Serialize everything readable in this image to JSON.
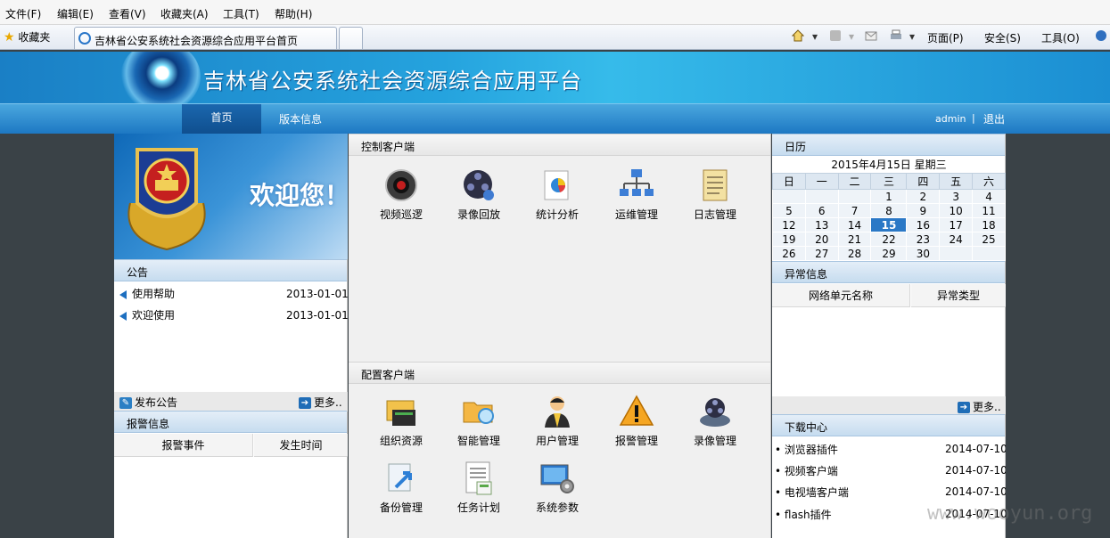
{
  "browser": {
    "menus": [
      "文件(F)",
      "编辑(E)",
      "查看(V)",
      "收藏夹(A)",
      "工具(T)",
      "帮助(H)"
    ],
    "favorites": "收藏夹",
    "tab_title": "吉林省公安系统社会资源综合应用平台首页",
    "cmd_page": "页面(P)",
    "cmd_safety": "安全(S)",
    "cmd_tools": "工具(O)"
  },
  "header": {
    "title": "吉林省公安系统社会资源综合应用平台",
    "nav_home": "首页",
    "nav_version": "版本信息",
    "user": "admin",
    "separator": "|",
    "logout": "退出"
  },
  "left": {
    "welcome": "欢迎您！",
    "notice_title": "公告",
    "notices": [
      {
        "title": "使用帮助",
        "date": "2013-01-01"
      },
      {
        "title": "欢迎使用",
        "date": "2013-01-01"
      }
    ],
    "publish": "发布公告",
    "more": "更多..",
    "alarm_title": "报警信息",
    "alarm_cols": [
      "报警事件",
      "发生时间"
    ]
  },
  "center": {
    "control_title": "控制客户端",
    "control_apps": [
      {
        "label": "视频巡逻",
        "icon": "camera-icon"
      },
      {
        "label": "录像回放",
        "icon": "film-reel-icon"
      },
      {
        "label": "统计分析",
        "icon": "pie-chart-icon"
      },
      {
        "label": "运维管理",
        "icon": "network-icon"
      },
      {
        "label": "日志管理",
        "icon": "notepad-icon"
      }
    ],
    "config_title": "配置客户端",
    "config_apps": [
      {
        "label": "组织资源",
        "icon": "folder-stack-icon"
      },
      {
        "label": "智能管理",
        "icon": "folder-search-icon"
      },
      {
        "label": "用户管理",
        "icon": "user-icon"
      },
      {
        "label": "报警管理",
        "icon": "warning-icon"
      },
      {
        "label": "录像管理",
        "icon": "video-manage-icon"
      },
      {
        "label": "备份管理",
        "icon": "backup-icon"
      },
      {
        "label": "任务计划",
        "icon": "task-list-icon"
      },
      {
        "label": "系统参数",
        "icon": "monitor-gear-icon"
      }
    ]
  },
  "right": {
    "calendar_title": "日历",
    "calendar_caption": "2015年4月15日  星期三",
    "weekdays": [
      "日",
      "一",
      "二",
      "三",
      "四",
      "五",
      "六"
    ],
    "weeks": [
      [
        "",
        "",
        "",
        "1",
        "2",
        "3",
        "4"
      ],
      [
        "5",
        "6",
        "7",
        "8",
        "9",
        "10",
        "11"
      ],
      [
        "12",
        "13",
        "14",
        "15",
        "16",
        "17",
        "18"
      ],
      [
        "19",
        "20",
        "21",
        "22",
        "23",
        "24",
        "25"
      ],
      [
        "26",
        "27",
        "28",
        "29",
        "30",
        "",
        ""
      ]
    ],
    "today": "15",
    "abnormal_title": "异常信息",
    "abnormal_cols": [
      "网络单元名称",
      "异常类型"
    ],
    "more": "更多..",
    "download_title": "下载中心",
    "downloads": [
      {
        "name": "• 浏览器插件",
        "date": "2014-07-10"
      },
      {
        "name": "• 视频客户端",
        "date": "2014-07-10"
      },
      {
        "name": "• 电视墙客户端",
        "date": "2014-07-10"
      },
      {
        "name": "• flash插件",
        "date": "2014-07-10"
      }
    ]
  },
  "watermark": "www.wooyun.org"
}
